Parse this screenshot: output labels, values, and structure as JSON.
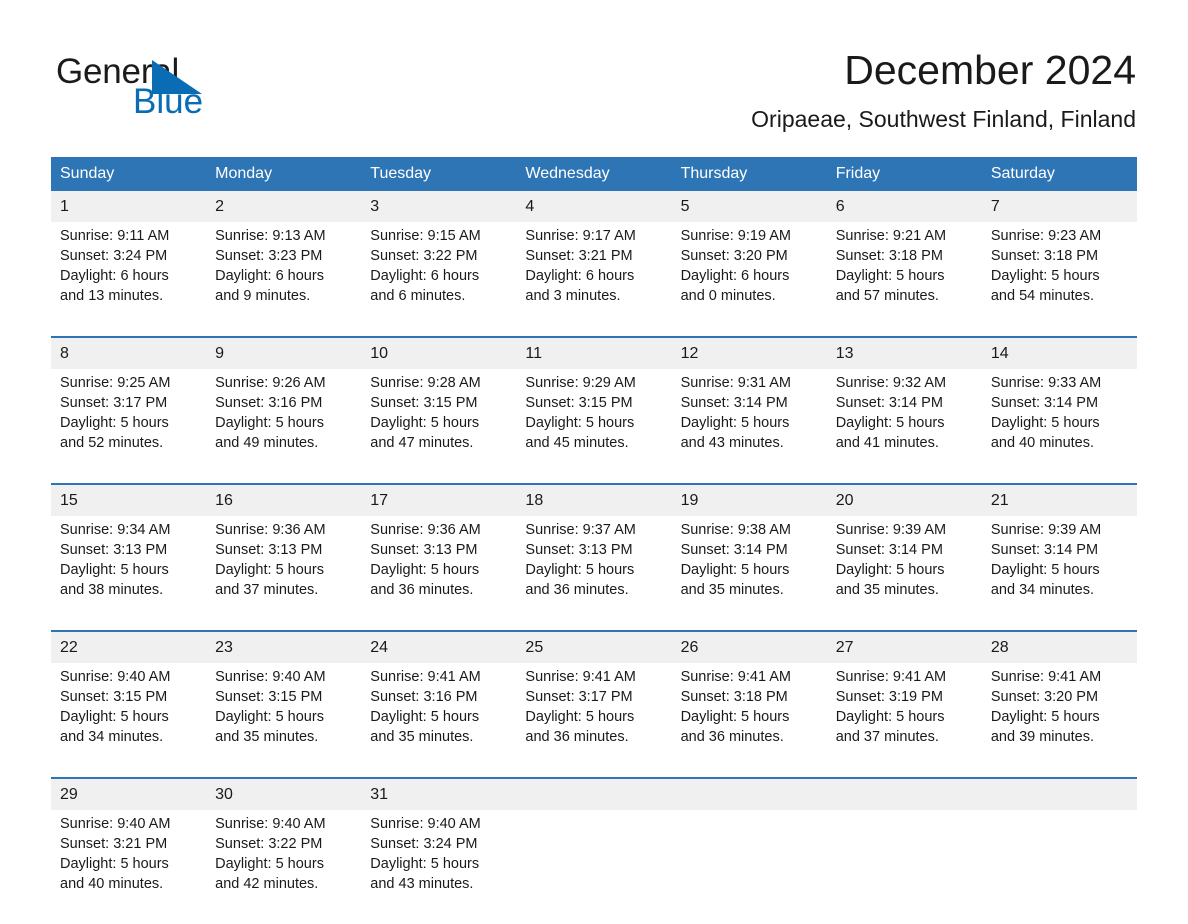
{
  "brand": {
    "word_one": "General",
    "word_two": "Blue",
    "triangle_color": "#0a6cb5"
  },
  "header": {
    "title": "December 2024",
    "subtitle": "Oripaeae, Southwest Finland, Finland"
  },
  "theme": {
    "header_blue": "#2e75b6",
    "date_band": "#f0f0f0",
    "text": "#1a1a1a"
  },
  "calendar": {
    "weekday_headers": [
      "Sunday",
      "Monday",
      "Tuesday",
      "Wednesday",
      "Thursday",
      "Friday",
      "Saturday"
    ],
    "weeks": [
      {
        "dates": [
          "1",
          "2",
          "3",
          "4",
          "5",
          "6",
          "7"
        ],
        "cells": [
          {
            "sunrise": "Sunrise: 9:11 AM",
            "sunset": "Sunset: 3:24 PM",
            "daylight1": "Daylight: 6 hours",
            "daylight2": "and 13 minutes."
          },
          {
            "sunrise": "Sunrise: 9:13 AM",
            "sunset": "Sunset: 3:23 PM",
            "daylight1": "Daylight: 6 hours",
            "daylight2": "and 9 minutes."
          },
          {
            "sunrise": "Sunrise: 9:15 AM",
            "sunset": "Sunset: 3:22 PM",
            "daylight1": "Daylight: 6 hours",
            "daylight2": "and 6 minutes."
          },
          {
            "sunrise": "Sunrise: 9:17 AM",
            "sunset": "Sunset: 3:21 PM",
            "daylight1": "Daylight: 6 hours",
            "daylight2": "and 3 minutes."
          },
          {
            "sunrise": "Sunrise: 9:19 AM",
            "sunset": "Sunset: 3:20 PM",
            "daylight1": "Daylight: 6 hours",
            "daylight2": "and 0 minutes."
          },
          {
            "sunrise": "Sunrise: 9:21 AM",
            "sunset": "Sunset: 3:18 PM",
            "daylight1": "Daylight: 5 hours",
            "daylight2": "and 57 minutes."
          },
          {
            "sunrise": "Sunrise: 9:23 AM",
            "sunset": "Sunset: 3:18 PM",
            "daylight1": "Daylight: 5 hours",
            "daylight2": "and 54 minutes."
          }
        ]
      },
      {
        "dates": [
          "8",
          "9",
          "10",
          "11",
          "12",
          "13",
          "14"
        ],
        "cells": [
          {
            "sunrise": "Sunrise: 9:25 AM",
            "sunset": "Sunset: 3:17 PM",
            "daylight1": "Daylight: 5 hours",
            "daylight2": "and 52 minutes."
          },
          {
            "sunrise": "Sunrise: 9:26 AM",
            "sunset": "Sunset: 3:16 PM",
            "daylight1": "Daylight: 5 hours",
            "daylight2": "and 49 minutes."
          },
          {
            "sunrise": "Sunrise: 9:28 AM",
            "sunset": "Sunset: 3:15 PM",
            "daylight1": "Daylight: 5 hours",
            "daylight2": "and 47 minutes."
          },
          {
            "sunrise": "Sunrise: 9:29 AM",
            "sunset": "Sunset: 3:15 PM",
            "daylight1": "Daylight: 5 hours",
            "daylight2": "and 45 minutes."
          },
          {
            "sunrise": "Sunrise: 9:31 AM",
            "sunset": "Sunset: 3:14 PM",
            "daylight1": "Daylight: 5 hours",
            "daylight2": "and 43 minutes."
          },
          {
            "sunrise": "Sunrise: 9:32 AM",
            "sunset": "Sunset: 3:14 PM",
            "daylight1": "Daylight: 5 hours",
            "daylight2": "and 41 minutes."
          },
          {
            "sunrise": "Sunrise: 9:33 AM",
            "sunset": "Sunset: 3:14 PM",
            "daylight1": "Daylight: 5 hours",
            "daylight2": "and 40 minutes."
          }
        ]
      },
      {
        "dates": [
          "15",
          "16",
          "17",
          "18",
          "19",
          "20",
          "21"
        ],
        "cells": [
          {
            "sunrise": "Sunrise: 9:34 AM",
            "sunset": "Sunset: 3:13 PM",
            "daylight1": "Daylight: 5 hours",
            "daylight2": "and 38 minutes."
          },
          {
            "sunrise": "Sunrise: 9:36 AM",
            "sunset": "Sunset: 3:13 PM",
            "daylight1": "Daylight: 5 hours",
            "daylight2": "and 37 minutes."
          },
          {
            "sunrise": "Sunrise: 9:36 AM",
            "sunset": "Sunset: 3:13 PM",
            "daylight1": "Daylight: 5 hours",
            "daylight2": "and 36 minutes."
          },
          {
            "sunrise": "Sunrise: 9:37 AM",
            "sunset": "Sunset: 3:13 PM",
            "daylight1": "Daylight: 5 hours",
            "daylight2": "and 36 minutes."
          },
          {
            "sunrise": "Sunrise: 9:38 AM",
            "sunset": "Sunset: 3:14 PM",
            "daylight1": "Daylight: 5 hours",
            "daylight2": "and 35 minutes."
          },
          {
            "sunrise": "Sunrise: 9:39 AM",
            "sunset": "Sunset: 3:14 PM",
            "daylight1": "Daylight: 5 hours",
            "daylight2": "and 35 minutes."
          },
          {
            "sunrise": "Sunrise: 9:39 AM",
            "sunset": "Sunset: 3:14 PM",
            "daylight1": "Daylight: 5 hours",
            "daylight2": "and 34 minutes."
          }
        ]
      },
      {
        "dates": [
          "22",
          "23",
          "24",
          "25",
          "26",
          "27",
          "28"
        ],
        "cells": [
          {
            "sunrise": "Sunrise: 9:40 AM",
            "sunset": "Sunset: 3:15 PM",
            "daylight1": "Daylight: 5 hours",
            "daylight2": "and 34 minutes."
          },
          {
            "sunrise": "Sunrise: 9:40 AM",
            "sunset": "Sunset: 3:15 PM",
            "daylight1": "Daylight: 5 hours",
            "daylight2": "and 35 minutes."
          },
          {
            "sunrise": "Sunrise: 9:41 AM",
            "sunset": "Sunset: 3:16 PM",
            "daylight1": "Daylight: 5 hours",
            "daylight2": "and 35 minutes."
          },
          {
            "sunrise": "Sunrise: 9:41 AM",
            "sunset": "Sunset: 3:17 PM",
            "daylight1": "Daylight: 5 hours",
            "daylight2": "and 36 minutes."
          },
          {
            "sunrise": "Sunrise: 9:41 AM",
            "sunset": "Sunset: 3:18 PM",
            "daylight1": "Daylight: 5 hours",
            "daylight2": "and 36 minutes."
          },
          {
            "sunrise": "Sunrise: 9:41 AM",
            "sunset": "Sunset: 3:19 PM",
            "daylight1": "Daylight: 5 hours",
            "daylight2": "and 37 minutes."
          },
          {
            "sunrise": "Sunrise: 9:41 AM",
            "sunset": "Sunset: 3:20 PM",
            "daylight1": "Daylight: 5 hours",
            "daylight2": "and 39 minutes."
          }
        ]
      },
      {
        "dates": [
          "29",
          "30",
          "31",
          "",
          "",
          "",
          ""
        ],
        "cells": [
          {
            "sunrise": "Sunrise: 9:40 AM",
            "sunset": "Sunset: 3:21 PM",
            "daylight1": "Daylight: 5 hours",
            "daylight2": "and 40 minutes."
          },
          {
            "sunrise": "Sunrise: 9:40 AM",
            "sunset": "Sunset: 3:22 PM",
            "daylight1": "Daylight: 5 hours",
            "daylight2": "and 42 minutes."
          },
          {
            "sunrise": "Sunrise: 9:40 AM",
            "sunset": "Sunset: 3:24 PM",
            "daylight1": "Daylight: 5 hours",
            "daylight2": "and 43 minutes."
          },
          {
            "sunrise": "",
            "sunset": "",
            "daylight1": "",
            "daylight2": ""
          },
          {
            "sunrise": "",
            "sunset": "",
            "daylight1": "",
            "daylight2": ""
          },
          {
            "sunrise": "",
            "sunset": "",
            "daylight1": "",
            "daylight2": ""
          },
          {
            "sunrise": "",
            "sunset": "",
            "daylight1": "",
            "daylight2": ""
          }
        ]
      }
    ]
  }
}
